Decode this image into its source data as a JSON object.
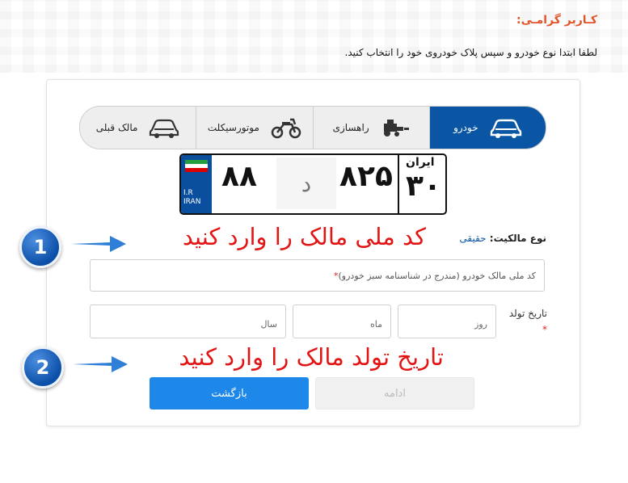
{
  "header": {
    "greeting": "کـاربر گرامـی:",
    "instruction": "لطفا ابتدا نوع خودرو و سپس پلاک خودروی خود را انتخاب کنید."
  },
  "tabs": [
    {
      "label": "خودرو",
      "icon": "car-icon",
      "active": true
    },
    {
      "label": "راهسازی",
      "icon": "tractor-icon",
      "active": false
    },
    {
      "label": "موتورسیکلت",
      "icon": "motorcycle-icon",
      "active": false
    },
    {
      "label": "مالک قبلی",
      "icon": "car-outline-icon",
      "active": false
    }
  ],
  "plate": {
    "country_en": "I.R IRAN",
    "pair": "۸۸",
    "letter": "د",
    "triple": "۸۲۵",
    "region_label": "ایران",
    "region": "۳۰"
  },
  "annotations": {
    "step1_number": "1",
    "step1_text": "کد ملی مالک را وارد کنید",
    "step2_number": "2",
    "step2_text": "تاریخ تولد مالک را وارد کنید"
  },
  "form": {
    "owner_type_label": "نوع مالکیت:",
    "owner_type_value": "حقیقی",
    "national_code_placeholder": "کد ملی مالک خودرو (مندرج در شناسنامه سبز خودرو)",
    "required_mark": "*",
    "dob_label": "تاریخ تولد",
    "day_placeholder": "روز",
    "month_placeholder": "ماه",
    "year_placeholder": "سال"
  },
  "buttons": {
    "next": "ادامه",
    "back": "بازگشت"
  },
  "colors": {
    "accent": "#0a56a5",
    "button_primary": "#1d87ea",
    "annotation_red": "#e31414",
    "greeting_orange": "#e0562b"
  }
}
